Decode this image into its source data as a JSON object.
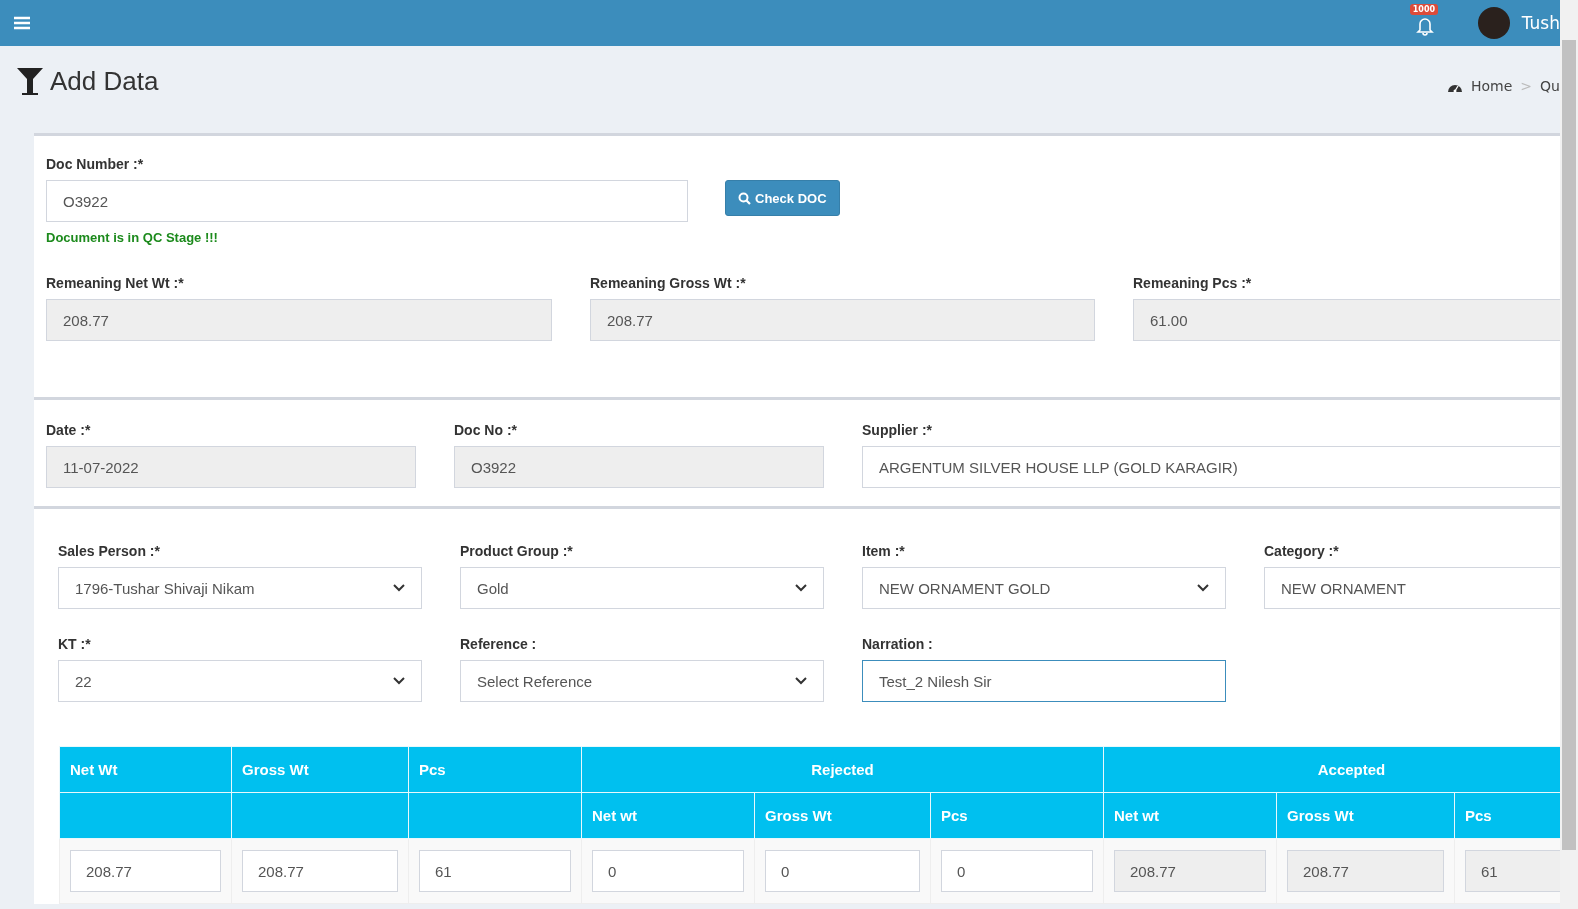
{
  "topbar": {
    "notification_count": "1000",
    "user_name": "Tush"
  },
  "page_title": "Add Data",
  "breadcrumb": {
    "items": [
      "Home",
      "Qu"
    ],
    "separator": ">"
  },
  "doc_check": {
    "label": "Doc Number :*",
    "value": "O3922",
    "button": "Check DOC",
    "message": "Document is in QC Stage !!!"
  },
  "remaining_fields": [
    {
      "label": "Remeaning Net Wt :*",
      "value": "208.77",
      "kind": "text",
      "disabled": true,
      "focused": false
    },
    {
      "label": "Remeaning Gross Wt :*",
      "value": "208.77",
      "kind": "text",
      "disabled": true,
      "focused": false
    },
    {
      "label": "Remeaning Pcs :*",
      "value": "61.00",
      "kind": "text",
      "disabled": true,
      "focused": false
    }
  ],
  "header_fields": [
    {
      "label": "Date :*",
      "value": "11-07-2022",
      "kind": "text",
      "disabled": true,
      "focused": false
    },
    {
      "label": "Doc No :*",
      "value": "O3922",
      "kind": "text",
      "disabled": true,
      "focused": false
    },
    {
      "label": "Supplier :*",
      "value": "ARGENTUM SILVER HOUSE LLP (GOLD KARAGIR)",
      "kind": "text",
      "disabled": false,
      "focused": false
    }
  ],
  "detail_fields": [
    {
      "label": "Sales Person :*",
      "value": "1796-Tushar Shivaji Nikam",
      "kind": "select",
      "disabled": false,
      "focused": false
    },
    {
      "label": "Product Group :*",
      "value": "Gold",
      "kind": "select",
      "disabled": false,
      "focused": false
    },
    {
      "label": "Item :*",
      "value": "NEW ORNAMENT GOLD",
      "kind": "select",
      "disabled": false,
      "focused": false
    },
    {
      "label": "Category :*",
      "value": "NEW ORNAMENT",
      "kind": "text",
      "disabled": false,
      "focused": false
    },
    {
      "label": "KT :*",
      "value": "22",
      "kind": "select",
      "disabled": false,
      "focused": false
    },
    {
      "label": "Reference :",
      "value": "Select Reference",
      "kind": "select",
      "disabled": false,
      "focused": false
    },
    {
      "label": "Narration :",
      "value": "Test_2 Nilesh Sir",
      "kind": "text",
      "disabled": false,
      "focused": true
    }
  ],
  "table": {
    "groups": [
      {
        "label": "Net Wt"
      },
      {
        "label": "Gross Wt"
      },
      {
        "label": "Pcs"
      },
      {
        "label": "Rejected",
        "subcolumns": [
          "Net wt",
          "Gross Wt",
          "Pcs"
        ]
      },
      {
        "label": "Accepted",
        "subcolumns": [
          "Net wt",
          "Gross Wt",
          "Pcs"
        ]
      }
    ],
    "row": [
      {
        "value": "208.77",
        "disabled": false
      },
      {
        "value": "208.77",
        "disabled": false
      },
      {
        "value": "61",
        "disabled": false
      },
      {
        "value": "0",
        "disabled": false
      },
      {
        "value": "0",
        "disabled": false
      },
      {
        "value": "0",
        "disabled": false
      },
      {
        "value": "208.77",
        "disabled": true
      },
      {
        "value": "208.77",
        "disabled": true
      },
      {
        "value": "61",
        "disabled": true
      }
    ]
  }
}
